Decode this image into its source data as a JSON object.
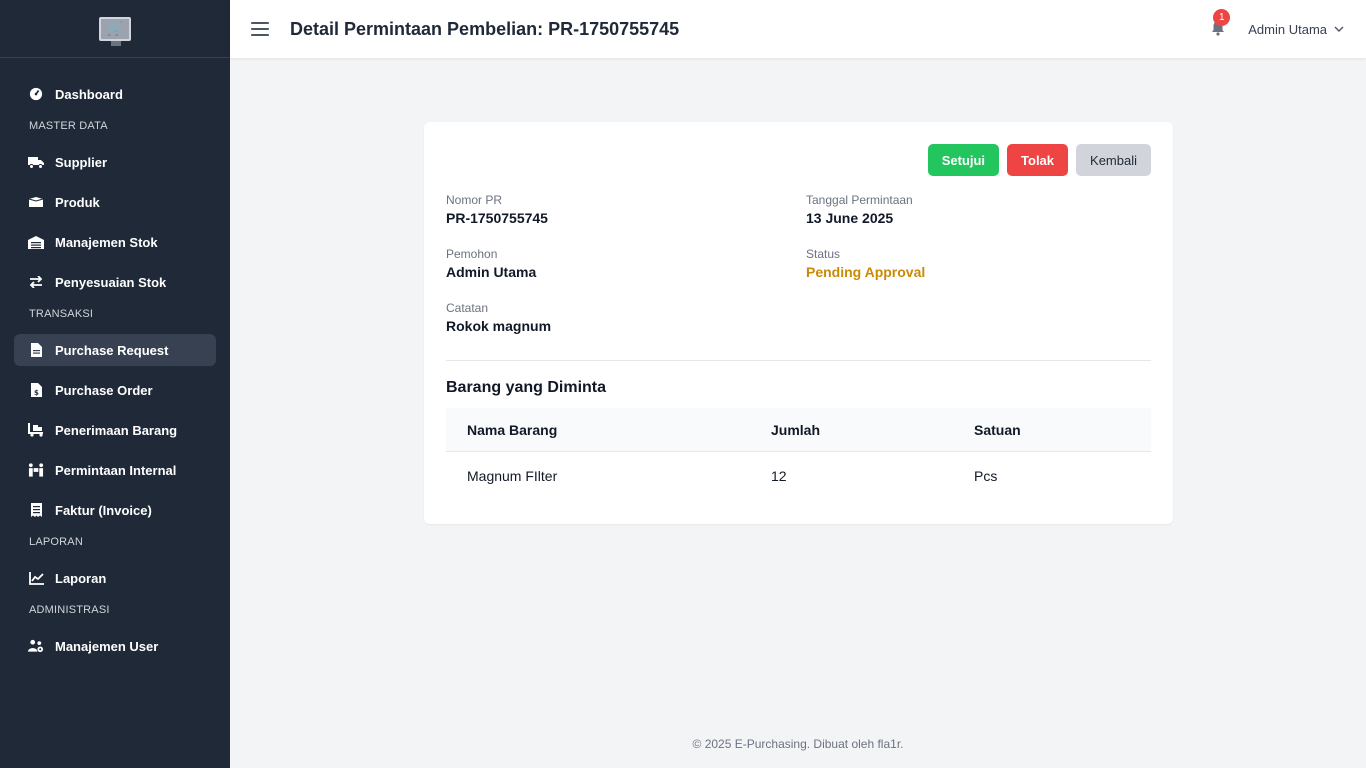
{
  "sidebar": {
    "items": [
      {
        "label": "Dashboard"
      },
      {
        "section": "MASTER DATA"
      },
      {
        "label": "Supplier"
      },
      {
        "label": "Produk"
      },
      {
        "label": "Manajemen Stok"
      },
      {
        "label": "Penyesuaian Stok"
      },
      {
        "section": "TRANSAKSI"
      },
      {
        "label": "Purchase Request"
      },
      {
        "label": "Purchase Order"
      },
      {
        "label": "Penerimaan Barang"
      },
      {
        "label": "Permintaan Internal"
      },
      {
        "label": "Faktur (Invoice)"
      },
      {
        "section": "LAPORAN"
      },
      {
        "label": "Laporan"
      },
      {
        "section": "ADMINISTRASI"
      },
      {
        "label": "Manajemen User"
      }
    ]
  },
  "header": {
    "title": "Detail Permintaan Pembelian: PR-1750755745",
    "notification_count": "1",
    "user_name": "Admin Utama"
  },
  "detail": {
    "buttons": {
      "approve": "Setujui",
      "reject": "Tolak",
      "back": "Kembali"
    },
    "nomor_pr": {
      "label": "Nomor PR",
      "value": "PR-1750755745"
    },
    "tanggal": {
      "label": "Tanggal Permintaan",
      "value": "13 June 2025"
    },
    "pemohon": {
      "label": "Pemohon",
      "value": "Admin Utama"
    },
    "status": {
      "label": "Status",
      "value": "Pending Approval"
    },
    "catatan": {
      "label": "Catatan",
      "value": "Rokok magnum"
    },
    "items_title": "Barang yang Diminta",
    "columns": [
      "Nama Barang",
      "Jumlah",
      "Satuan"
    ],
    "rows": [
      [
        "Magnum FIlter",
        "12",
        "Pcs"
      ]
    ]
  },
  "footer": "© 2025 E-Purchasing. Dibuat oleh fla1r.",
  "colors": {
    "sidebar": "#1f2937",
    "approve": "#22c55e",
    "reject": "#ef4444",
    "pending": "#ca8a04"
  }
}
